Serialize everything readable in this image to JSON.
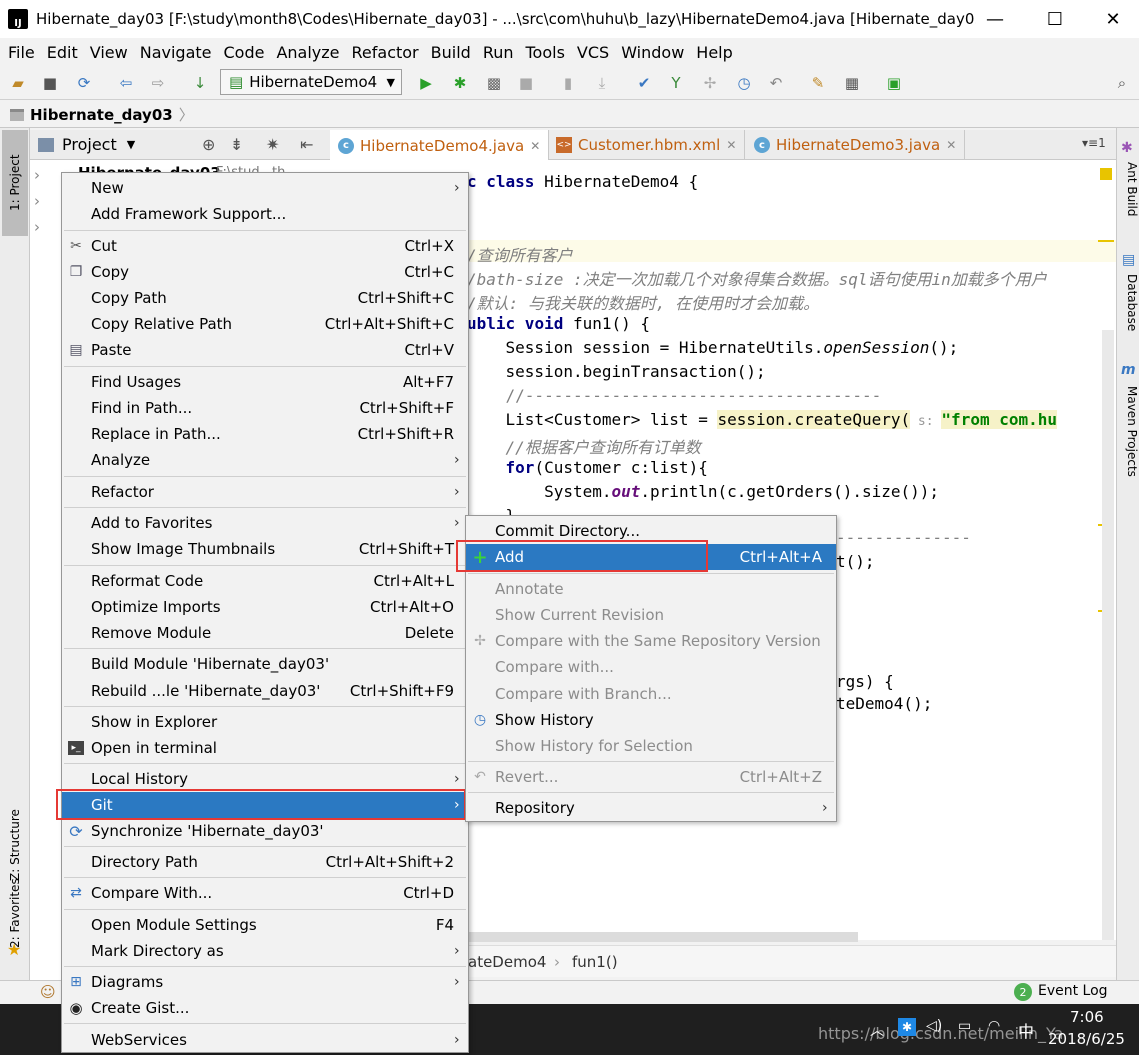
{
  "window": {
    "title": "Hibernate_day03 [F:\\study\\month8\\Codes\\Hibernate_day03] - ...\\src\\com\\huhu\\b_lazy\\HibernateDemo4.java [Hibernate_day0...",
    "app_icon": "IJ",
    "minimize": "—",
    "maximize": "☐",
    "close": "✕"
  },
  "menubar": [
    "File",
    "Edit",
    "View",
    "Navigate",
    "Code",
    "Analyze",
    "Refactor",
    "Build",
    "Run",
    "Tools",
    "VCS",
    "Window",
    "Help"
  ],
  "toolbar": {
    "run_config": "HibernateDemo4"
  },
  "breadcrumb": "Hibernate_day03",
  "left_tool_windows": {
    "project": "1: Project",
    "structure": "Z: Structure",
    "favorites": "2: Favorites"
  },
  "right_tool_windows": {
    "ant": "Ant Build",
    "database": "Database",
    "maven": "Maven Projects"
  },
  "project_panel": {
    "title": "Project",
    "first_item": "Hibernate_day03",
    "first_item_suffix": "F:\\stud...th"
  },
  "editor_tabs": [
    {
      "label": "HibernateDemo4.java",
      "icon": "c-class-icon"
    },
    {
      "label": "Customer.hbm.xml",
      "icon": "xml-icon"
    },
    {
      "label": "HibernateDemo3.java",
      "icon": "c-class-icon"
    }
  ],
  "tab_count": "1",
  "code": {
    "l1a": "c ",
    "l1b": "class",
    "l1c": " HibernateDemo4 {",
    "l2": "/查询所有客户",
    "l3": "/bath-size :决定一次加载几个对象得集合数据。sql语句使用in加载多个用户",
    "l4": "/默认: 与我关联的数据时, 在使用时才会加载。",
    "l5a": "ublic",
    "l5b": " void",
    "l5c": " fun1() {",
    "l6a": "    Session session = HibernateUtils.",
    "l6b": "openSession",
    "l6c": "();",
    "l7": "    session.beginTransaction();",
    "l8": "    //-------------------------------------",
    "l9a": "    List<Customer> list = ",
    "l9b": "session.createQuery(",
    "l9c": " s: ",
    "l9d": "\"from com.hu",
    "l10": "    //根据客户查询所有订单数",
    "l11a": "    ",
    "l11b": "for",
    "l11c": "(Customer c:list){",
    "l12a": "        System.",
    "l12b": "out",
    "l12c": ".println(c.getOrders().size());",
    "l13": "    }",
    "l14": "--------------",
    "l15": "t();",
    "l16": "rgs) {",
    "l17": "teDemo4();"
  },
  "editor_breadcrumb": {
    "class": "ateDemo4",
    "sep": "›",
    "method": "fun1()"
  },
  "status": {
    "event_log": "Event Log",
    "event_count": "2"
  },
  "taskbar": {
    "time": "7:06",
    "date": "2018/6/25",
    "ime": "中",
    "watermark": "https://blog.csdn.net/meilin_Ya"
  },
  "context_menu": [
    {
      "label": "New",
      "shortcut": "",
      "submenu": true
    },
    {
      "label": "Add Framework Support...",
      "shortcut": ""
    },
    {
      "label": "Cut",
      "shortcut": "Ctrl+X",
      "icon": "scissors-icon"
    },
    {
      "label": "Copy",
      "shortcut": "Ctrl+C",
      "icon": "copy-icon"
    },
    {
      "label": "Copy Path",
      "shortcut": "Ctrl+Shift+C"
    },
    {
      "label": "Copy Relative Path",
      "shortcut": "Ctrl+Alt+Shift+C"
    },
    {
      "label": "Paste",
      "shortcut": "Ctrl+V",
      "icon": "paste-icon"
    },
    {
      "label": "Find Usages",
      "shortcut": "Alt+F7"
    },
    {
      "label": "Find in Path...",
      "shortcut": "Ctrl+Shift+F"
    },
    {
      "label": "Replace in Path...",
      "shortcut": "Ctrl+Shift+R"
    },
    {
      "label": "Analyze",
      "shortcut": "",
      "submenu": true
    },
    {
      "label": "Refactor",
      "shortcut": "",
      "submenu": true
    },
    {
      "label": "Add to Favorites",
      "shortcut": "",
      "submenu": true
    },
    {
      "label": "Show Image Thumbnails",
      "shortcut": "Ctrl+Shift+T"
    },
    {
      "label": "Reformat Code",
      "shortcut": "Ctrl+Alt+L"
    },
    {
      "label": "Optimize Imports",
      "shortcut": "Ctrl+Alt+O"
    },
    {
      "label": "Remove Module",
      "shortcut": "Delete"
    },
    {
      "label": "Build Module 'Hibernate_day03'",
      "shortcut": ""
    },
    {
      "label": "Rebuild ...le 'Hibernate_day03'",
      "shortcut": "Ctrl+Shift+F9"
    },
    {
      "label": "Show in Explorer",
      "shortcut": ""
    },
    {
      "label": "Open in terminal",
      "shortcut": "",
      "icon": "terminal-icon"
    },
    {
      "label": "Local History",
      "shortcut": "",
      "submenu": true
    },
    {
      "label": "Git",
      "shortcut": "",
      "submenu": true,
      "selected": true
    },
    {
      "label": "Synchronize 'Hibernate_day03'",
      "shortcut": "",
      "icon": "sync-icon"
    },
    {
      "label": "Directory Path",
      "shortcut": "Ctrl+Alt+Shift+2"
    },
    {
      "label": "Compare With...",
      "shortcut": "Ctrl+D",
      "icon": "compare-icon"
    },
    {
      "label": "Open Module Settings",
      "shortcut": "F4"
    },
    {
      "label": "Mark Directory as",
      "shortcut": "",
      "submenu": true
    },
    {
      "label": "Diagrams",
      "shortcut": "",
      "submenu": true,
      "icon": "diagram-icon"
    },
    {
      "label": "Create Gist...",
      "shortcut": "",
      "icon": "github-icon"
    },
    {
      "label": "WebServices",
      "shortcut": "",
      "submenu": true
    }
  ],
  "git_submenu": [
    {
      "label": "Commit Directory...",
      "shortcut": ""
    },
    {
      "label": "Add",
      "shortcut": "Ctrl+Alt+A",
      "selected": true,
      "icon": "plus-icon"
    },
    {
      "label": "Annotate",
      "shortcut": "",
      "disabled": true
    },
    {
      "label": "Show Current Revision",
      "shortcut": "",
      "disabled": true
    },
    {
      "label": "Compare with the Same Repository Version",
      "shortcut": "",
      "disabled": true,
      "icon": "compare-icon"
    },
    {
      "label": "Compare with...",
      "shortcut": "",
      "disabled": true
    },
    {
      "label": "Compare with Branch...",
      "shortcut": "",
      "disabled": true
    },
    {
      "label": "Show History",
      "shortcut": "",
      "icon": "history-icon"
    },
    {
      "label": "Show History for Selection",
      "shortcut": "",
      "disabled": true
    },
    {
      "label": "Revert...",
      "shortcut": "Ctrl+Alt+Z",
      "disabled": true,
      "icon": "revert-icon"
    },
    {
      "label": "Repository",
      "shortcut": "",
      "submenu": true
    }
  ],
  "colors": {
    "selection": "#2b79c2",
    "highlight_box": "#e53935",
    "keyword": "#000080",
    "comment": "#808080",
    "string": "#008000"
  }
}
